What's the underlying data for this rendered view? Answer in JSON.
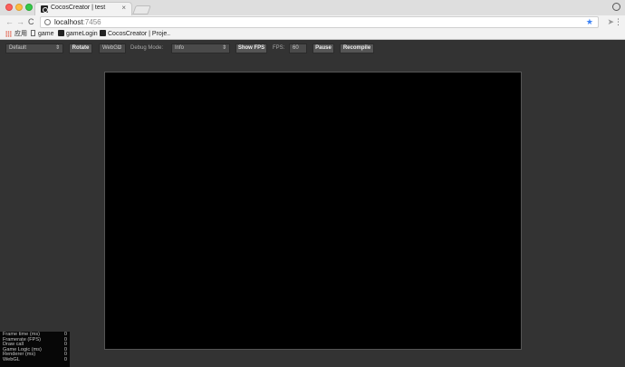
{
  "browser": {
    "tab_title": "CocosCreator | test",
    "tab_close": "×",
    "url_host": "localhost",
    "url_port": ":7456",
    "nav_back": "←",
    "nav_forward": "→",
    "nav_reload": "C",
    "star_glyph": "★",
    "menu_glyph": "⋮"
  },
  "bookmarks": [
    {
      "label": "应用",
      "icon": "apps-grid-icon"
    },
    {
      "label": "game",
      "icon": "page-icon"
    },
    {
      "label": "gameLogin",
      "icon": "cocos-icon"
    },
    {
      "label": "CocosCreator | Proje..",
      "icon": "cocos-icon"
    }
  ],
  "preview_toolbar": {
    "device_select": "Default",
    "rotate_label": "Rotate",
    "renderer_select": "WebGL",
    "debug_mode_label": "Debug Mode:",
    "debug_mode_select": "Info",
    "show_fps_label": "Show FPS",
    "fps_label": "FPS:",
    "fps_value": "60",
    "pause_label": "Pause",
    "recompile_label": "Recompile",
    "select_arrow": "⇕"
  },
  "stats": [
    {
      "label": "Frame time (ms)",
      "value": "0"
    },
    {
      "label": "Framerate (FPS)",
      "value": "0"
    },
    {
      "label": "Draw call",
      "value": "0"
    },
    {
      "label": "Game Logic (ms)",
      "value": "0"
    },
    {
      "label": "Renderer (ms)",
      "value": "0"
    },
    {
      "label": "WebGL",
      "value": "0"
    }
  ],
  "colors": {
    "background": "#333333",
    "canvas": "#000000",
    "star": "#3b82f6"
  }
}
